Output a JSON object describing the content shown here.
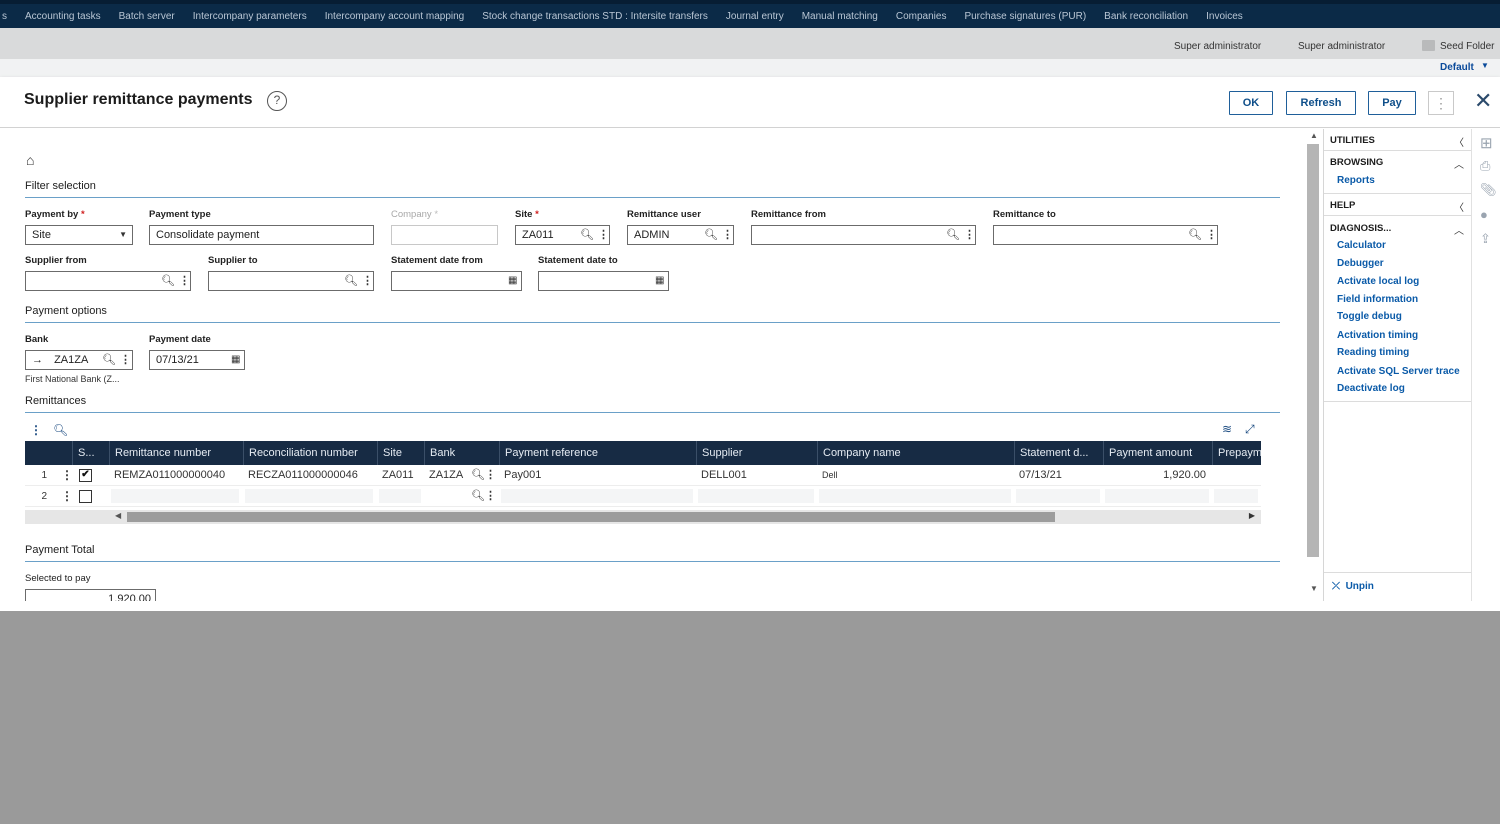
{
  "topnav": {
    "items": [
      "s",
      "Accounting tasks",
      "Batch server",
      "Intercompany parameters",
      "Intercompany account mapping",
      "Stock change transactions STD : Intersite transfers",
      "Journal entry",
      "Manual matching",
      "Companies",
      "Purchase signatures (PUR)",
      "Bank reconciliation",
      "Invoices"
    ]
  },
  "userbar": {
    "user1": "Super administrator",
    "user2": "Super administrator",
    "folder": "Seed Folder",
    "default_label": "Default"
  },
  "window": {
    "title": "Supplier remittance payments",
    "help_icon": "?",
    "buttons": {
      "ok": "OK",
      "refresh": "Refresh",
      "pay": "Pay"
    }
  },
  "filter": {
    "section_title": "Filter selection",
    "payment_by": {
      "label": "Payment by",
      "value": "Site"
    },
    "payment_type": {
      "label": "Payment type",
      "value": "Consolidate payment"
    },
    "company": {
      "label": "Company",
      "value": ""
    },
    "site": {
      "label": "Site",
      "value": "ZA011"
    },
    "remittance_user": {
      "label": "Remittance user",
      "value": "ADMIN"
    },
    "remittance_from": {
      "label": "Remittance from",
      "value": ""
    },
    "remittance_to": {
      "label": "Remittance to",
      "value": ""
    },
    "supplier_from": {
      "label": "Supplier from",
      "value": ""
    },
    "supplier_to": {
      "label": "Supplier to",
      "value": ""
    },
    "statement_date_from": {
      "label": "Statement date from",
      "value": ""
    },
    "statement_date_to": {
      "label": "Statement date to",
      "value": ""
    },
    "required_mark": "*"
  },
  "payment_options": {
    "section_title": "Payment options",
    "bank": {
      "label": "Bank",
      "value": "ZA1ZA",
      "hint": "First National Bank (Z..."
    },
    "payment_date": {
      "label": "Payment date",
      "value": "07/13/21"
    }
  },
  "remittances": {
    "section_title": "Remittances",
    "columns": [
      "S...",
      "Remittance number",
      "Reconciliation number",
      "Site",
      "Bank",
      "Payment reference",
      "Supplier",
      "Company name",
      "Statement d...",
      "Payment amount",
      "Prepaym"
    ],
    "rows": [
      {
        "num": "1",
        "selected": "✔",
        "remittance_number": "REMZA011000000040",
        "reconciliation_number": "RECZA011000000046",
        "site": "ZA011",
        "bank": "ZA1ZA",
        "payment_reference": "Pay001",
        "supplier": "DELL001",
        "company_name": "Dell",
        "statement_date": "07/13/21",
        "payment_amount": "1,920.00"
      },
      {
        "num": "2",
        "selected": ""
      }
    ]
  },
  "payment_total": {
    "section_title": "Payment Total",
    "selected_to_pay_label": "Selected to pay",
    "selected_to_pay_value": "1,920.00"
  },
  "right_panel": {
    "utilities": "UTILITIES",
    "browsing": "BROWSING",
    "reports": "Reports",
    "help": "HELP",
    "diagnosis": "DIAGNOSIS...",
    "diagnosis_links": [
      "Calculator",
      "Debugger",
      "Activate local log",
      "Field information",
      "Toggle debug",
      "Activation timing",
      "Reading timing",
      "Activate SQL Server trace",
      "Deactivate log"
    ],
    "unpin": "Unpin"
  },
  "colors": {
    "topnav_bg": "#0b2a47",
    "grid_header_bg": "#172b44",
    "link_blue": "#0a5aa8",
    "button_border": "#1f5f9a",
    "required": "#d02020"
  }
}
